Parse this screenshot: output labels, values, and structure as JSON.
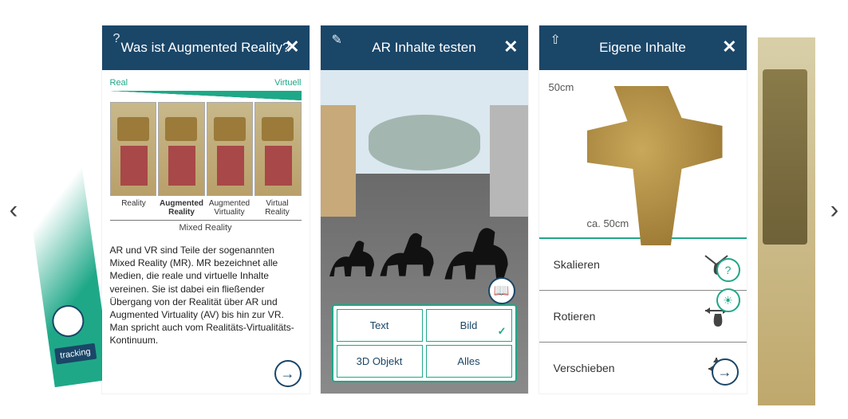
{
  "nav": {
    "prev": "‹",
    "next": "›"
  },
  "peek_left": {
    "button_label": "tracking"
  },
  "screen1": {
    "header_icon": "?",
    "title": "Was ist Augmented Reality?",
    "close": "✕",
    "scale_left": "Real",
    "scale_right": "Virtuell",
    "labels": {
      "l1": "Reality",
      "l2": "Augmented Reality",
      "l3": "Augmented Virtuality",
      "l4": "Virtual Reality"
    },
    "mixed": "Mixed Reality",
    "body": "AR und VR sind Teile der sogenannten Mixed Reality (MR). MR bezeichnet alle Medien, die reale und virtuelle Inhalte vereinen. Sie ist dabei ein fließender Übergang von der Realität über AR und Augmented Virtuality (AV) bis hin zur VR. Man spricht auch vom Realitäts-Virtualitäts-Kontinuum.",
    "next": "→"
  },
  "screen2": {
    "header_icon": "✎",
    "title": "AR Inhalte testen",
    "close": "✕",
    "buttons": {
      "text": "Text",
      "image": "Bild",
      "object3d": "3D Objekt",
      "all": "Alles"
    },
    "book_icon": "📖"
  },
  "screen3": {
    "header_icon": "⇧",
    "title": "Eigene Inhalte",
    "close": "✕",
    "scale_v": "50cm",
    "scale_h": "ca. 50cm",
    "rows": {
      "scale": "Skalieren",
      "rotate": "Rotieren",
      "move": "Verschieben"
    },
    "help": "?",
    "sun": "☀",
    "next": "→"
  }
}
